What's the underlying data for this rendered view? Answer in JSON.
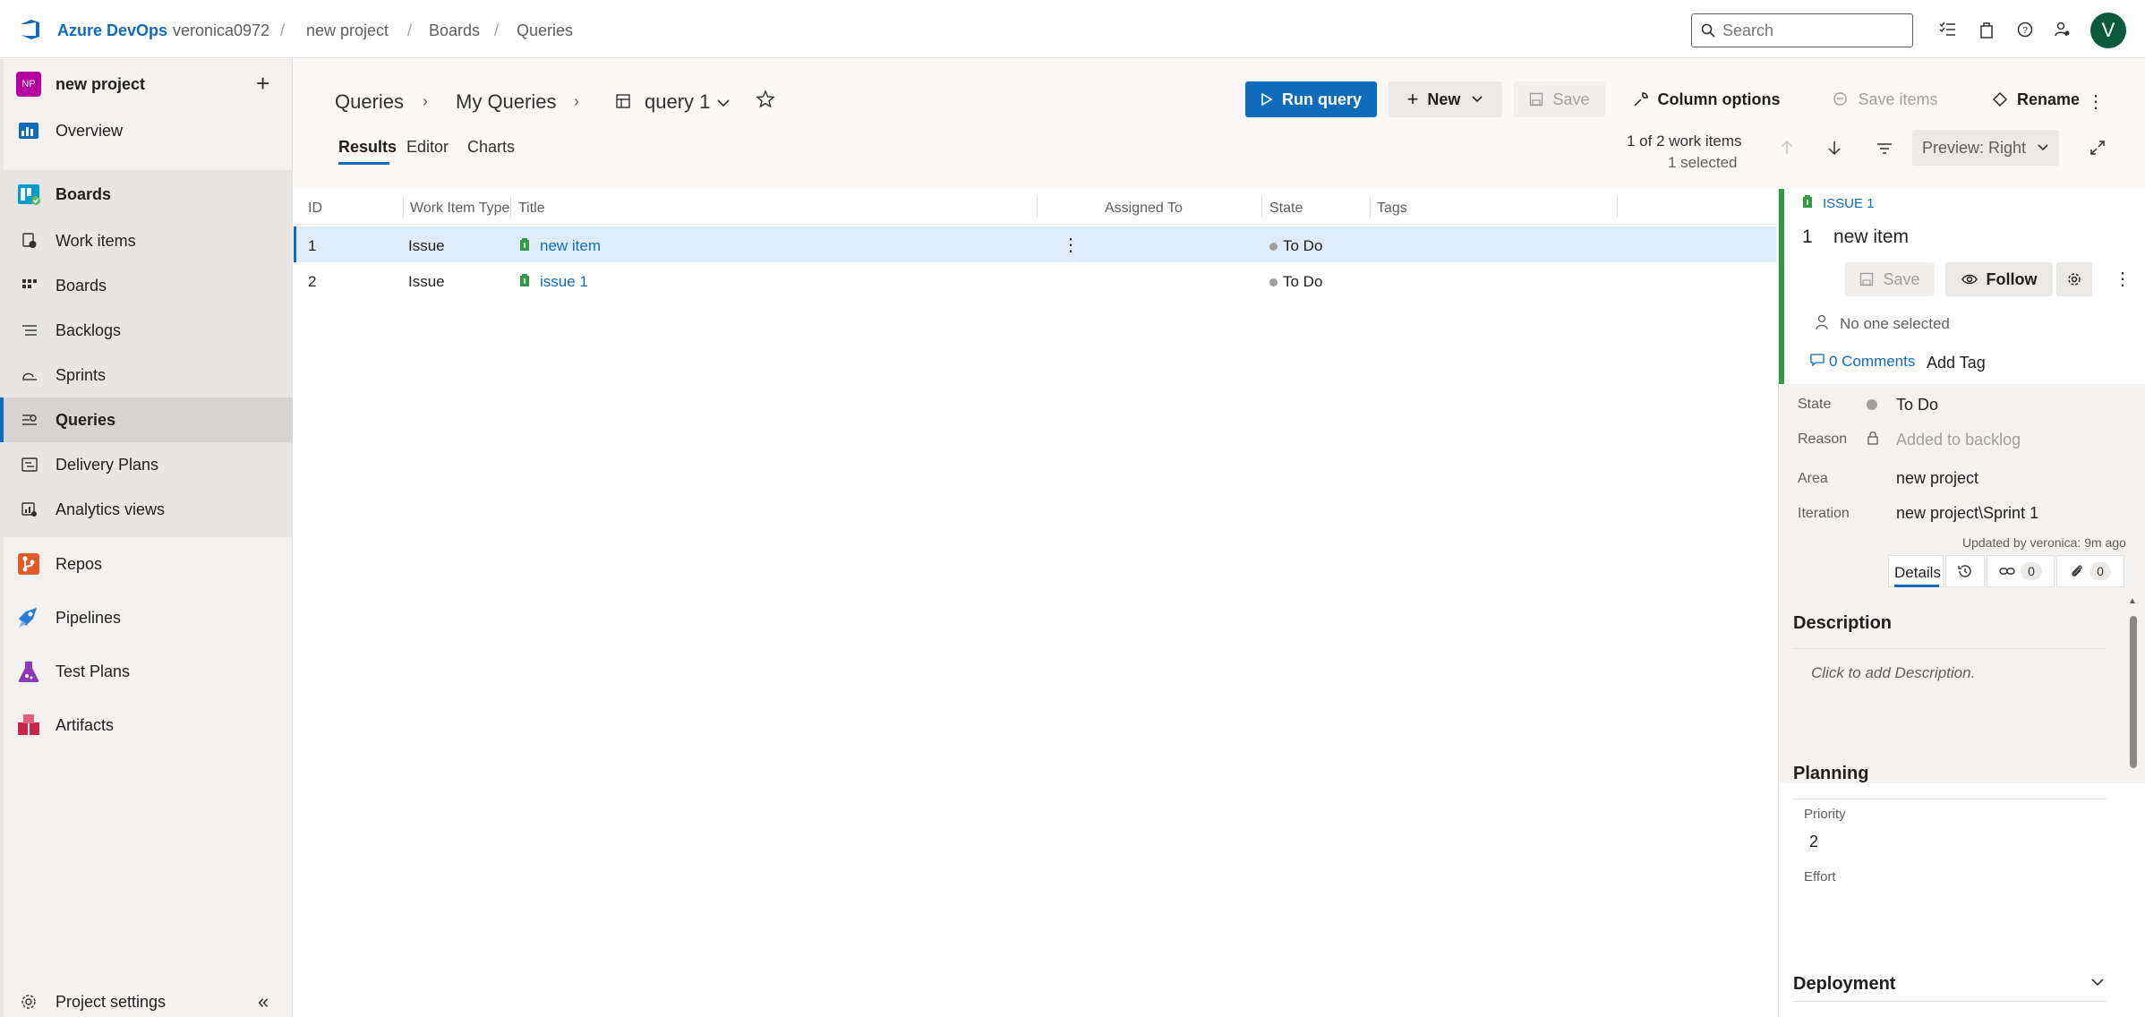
{
  "topbar": {
    "brand": "Azure DevOps",
    "org": "veronica0972",
    "project": "new project",
    "section": "Boards",
    "page": "Queries",
    "search_placeholder": "Search",
    "avatar_initial": "V"
  },
  "sidebar": {
    "project_badge": "NP",
    "project_name": "new project",
    "items": [
      {
        "label": "Overview"
      },
      {
        "label": "Boards"
      },
      {
        "label": "Work items"
      },
      {
        "label": "Boards"
      },
      {
        "label": "Backlogs"
      },
      {
        "label": "Sprints"
      },
      {
        "label": "Queries"
      },
      {
        "label": "Delivery Plans"
      },
      {
        "label": "Analytics views"
      },
      {
        "label": "Repos"
      },
      {
        "label": "Pipelines"
      },
      {
        "label": "Test Plans"
      },
      {
        "label": "Artifacts"
      }
    ],
    "settings_label": "Project settings"
  },
  "header": {
    "crumb_queries": "Queries",
    "crumb_my": "My Queries",
    "query_name": "query 1",
    "run_label": "Run query",
    "new_label": "New",
    "save_label": "Save",
    "column_options": "Column options",
    "save_items": "Save items",
    "rename": "Rename",
    "tabs": [
      {
        "label": "Results"
      },
      {
        "label": "Editor"
      },
      {
        "label": "Charts"
      }
    ],
    "count": "1 of 2 work items",
    "selected": "1 selected",
    "preview": "Preview: Right"
  },
  "grid": {
    "columns": [
      "ID",
      "Work Item Type",
      "Title",
      "Assigned To",
      "State",
      "Tags"
    ],
    "rows": [
      {
        "id": "1",
        "type": "Issue",
        "title": "new item",
        "assigned": "",
        "state": "To Do",
        "tags": ""
      },
      {
        "id": "2",
        "type": "Issue",
        "title": "issue 1",
        "assigned": "",
        "state": "To Do",
        "tags": ""
      }
    ]
  },
  "panel": {
    "type_label": "ISSUE 1",
    "item_id": "1",
    "item_title": "new item",
    "save": "Save",
    "follow": "Follow",
    "assigned": "No one selected",
    "comments": "0 Comments",
    "add_tag": "Add Tag",
    "state_label": "State",
    "state_value": "To Do",
    "reason_label": "Reason",
    "reason_value": "Added to backlog",
    "area_label": "Area",
    "area_value": "new project",
    "iteration_label": "Iteration",
    "iteration_value": "new project\\Sprint 1",
    "updated": "Updated by veronica: 9m ago",
    "details_tab": "Details",
    "links_count": "0",
    "attach_count": "0",
    "description_title": "Description",
    "description_placeholder": "Click to add Description.",
    "planning_title": "Planning",
    "priority_label": "Priority",
    "priority_value": "2",
    "effort_label": "Effort",
    "deployment_title": "Deployment"
  },
  "colors": {
    "accent": "#0f6cbd",
    "issue_green": "#339947",
    "sidebar_bg": "#f3f2f1"
  }
}
